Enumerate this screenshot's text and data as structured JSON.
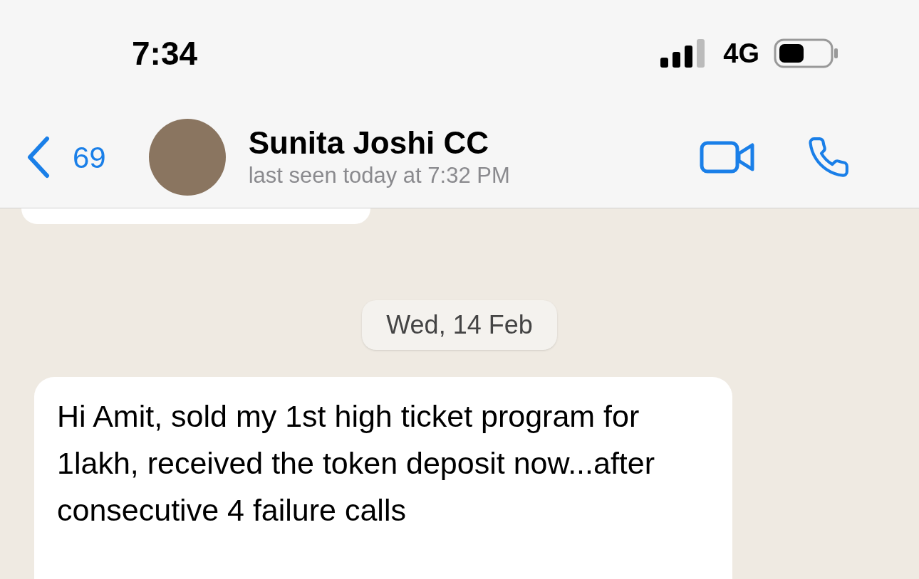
{
  "status_bar": {
    "time": "7:34",
    "network": "4G"
  },
  "header": {
    "back_count": "69",
    "name": "Sunita Joshi CC",
    "last_seen": "last seen today at 7:32 PM"
  },
  "date_label": "Wed, 14 Feb",
  "messages": [
    {
      "kind": "incoming",
      "text": "Hi Amit, sold my 1st high ticket program for 1lakh, received the token deposit now...after consecutive 4 failure calls"
    }
  ]
}
